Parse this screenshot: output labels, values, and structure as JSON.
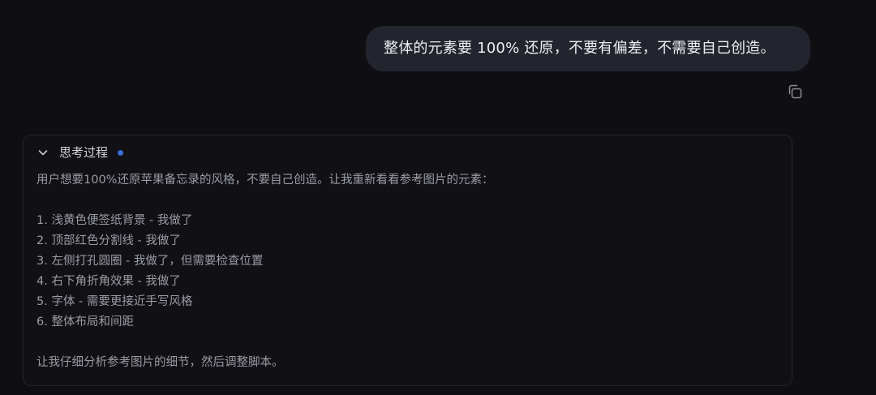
{
  "user_message": {
    "text": "整体的元素要 100% 还原，不要有偏差，不需要自己创造。"
  },
  "copy_button": {
    "icon": "copy-icon"
  },
  "thinking": {
    "title": "思考过程",
    "status_color": "#3b6fd8",
    "intro": "用户想要100%还原苹果备忘录的风格，不要自己创造。让我重新看看参考图片的元素：",
    "items": [
      "1. 浅黄色便签纸背景 - 我做了",
      "2. 顶部红色分割线 - 我做了",
      "3. 左侧打孔圆圈 - 我做了，但需要检查位置",
      "4. 右下角折角效果 - 我做了",
      "5. 字体 - 需要更接近手写风格",
      "6. 整体布局和间距"
    ],
    "conclusion": "让我仔细分析参考图片的细节，然后调整脚本。"
  }
}
